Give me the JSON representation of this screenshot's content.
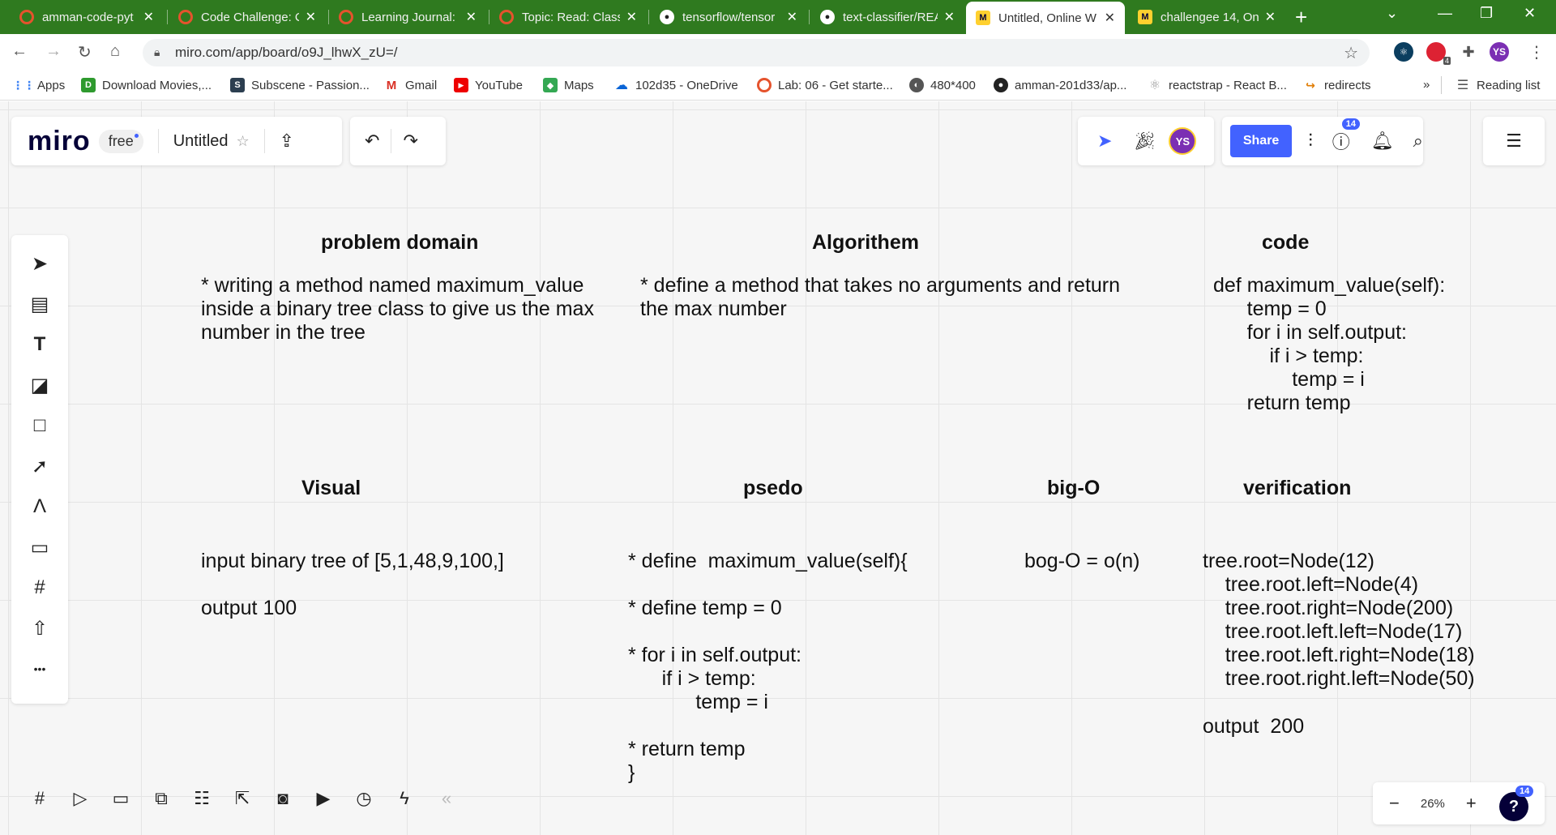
{
  "browser": {
    "tabs": [
      {
        "title": "amman-code-pyt",
        "favicon": "redhat-icon"
      },
      {
        "title": "Code Challenge: C",
        "favicon": "redhat-icon"
      },
      {
        "title": "Learning Journal:",
        "favicon": "redhat-icon"
      },
      {
        "title": "Topic: Read: Class",
        "favicon": "redhat-icon"
      },
      {
        "title": "tensorflow/tensor",
        "favicon": "github-icon"
      },
      {
        "title": "text-classifier/REA",
        "favicon": "github-icon"
      },
      {
        "title": "Untitled, Online W",
        "favicon": "miro-icon",
        "active": true
      },
      {
        "title": "challengee 14, On",
        "favicon": "miro-icon"
      }
    ],
    "close_glyph": "✕",
    "new_tab_glyph": "+",
    "url": "miro.com/app/board/o9J_lhwX_zU=/",
    "extension_badge": "4",
    "profile_initials": "YS",
    "bookmarks": [
      {
        "label": "Apps",
        "icon": "apps-grid-icon"
      },
      {
        "label": "Download Movies,...",
        "icon": "download-site-icon"
      },
      {
        "label": "Subscene - Passion...",
        "icon": "subscene-icon"
      },
      {
        "label": "Gmail",
        "icon": "gmail-icon"
      },
      {
        "label": "YouTube",
        "icon": "youtube-icon"
      },
      {
        "label": "Maps",
        "icon": "maps-icon"
      },
      {
        "label": "102d35 - OneDrive",
        "icon": "onedrive-icon"
      },
      {
        "label": "Lab: 06 - Get starte...",
        "icon": "redhat-icon"
      },
      {
        "label": "480*400",
        "icon": "globe-icon"
      },
      {
        "label": "amman-201d33/ap...",
        "icon": "github-icon"
      },
      {
        "label": "reactstrap - React B...",
        "icon": "react-icon"
      },
      {
        "label": "redirects",
        "icon": "redirects-icon"
      }
    ],
    "more_bookmarks": "»",
    "reading_list": "Reading list"
  },
  "miro": {
    "logo": "miro",
    "plan": "free",
    "board_name": "Untitled",
    "share_label": "Share",
    "help_badge": "14",
    "zoom_level": "26%",
    "zoom_minus": "−",
    "zoom_plus": "+",
    "help_glyph": "?",
    "more_glyph": "•••",
    "collapse_glyph": "«"
  },
  "board": {
    "problem_domain": {
      "title": "problem domain",
      "body": "* writing a method named maximum_value\ninside a binary tree class to give us the max\nnumber in the tree"
    },
    "algorithm": {
      "title": "Algorithem",
      "body": "* define a method that takes no arguments and return\nthe max number"
    },
    "code": {
      "title": "code",
      "body": "def maximum_value(self):\n      temp = 0\n      for i in self.output:\n          if i > temp:\n              temp = i\n      return temp"
    },
    "visual": {
      "title": "Visual",
      "input": "input binary tree of [5,1,48,9,100,]",
      "output": "output 100"
    },
    "pseudo": {
      "title": "psedo",
      "body": "* define  maximum_value(self){\n\n* define temp = 0\n\n* for i in self.output:\n      if i > temp:\n            temp = i\n\n* return temp\n}"
    },
    "big_o": {
      "title": "big-O",
      "body": "bog-O = o(n)"
    },
    "verification": {
      "title": "verification",
      "body": "tree.root=Node(12)\n    tree.root.left=Node(4)\n    tree.root.right=Node(200)\n    tree.root.left.left=Node(17)\n    tree.root.left.right=Node(18)\n    tree.root.right.left=Node(50)",
      "output": "output  200"
    }
  }
}
